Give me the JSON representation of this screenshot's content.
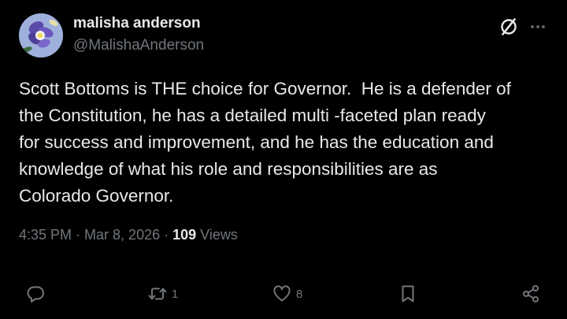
{
  "tweet": {
    "author": {
      "display_name": "malisha anderson",
      "handle": "@MalishaAnderson"
    },
    "text_lines": [
      "Scott Bottoms is THE choice for Governor.  He is a defender of",
      "the Constitution, he has a detailed multi -faceted plan ready",
      "for success and improvement, and he has the education and",
      "knowledge of what his role and responsibilities are as",
      "Colorado Governor."
    ],
    "meta": {
      "time": "4:35 PM",
      "separator1": " · ",
      "date": "Mar 8, 2026",
      "separator2": " · ",
      "views_count": "109",
      "views_label": " Views"
    },
    "actions": {
      "reply": {
        "icon": "reply-icon",
        "count": ""
      },
      "repost": {
        "icon": "repost-icon",
        "count": "1"
      },
      "like": {
        "icon": "heart-icon",
        "count": "8"
      },
      "bookmark": {
        "icon": "bookmark-icon",
        "count": ""
      },
      "share": {
        "icon": "share-icon",
        "count": ""
      }
    }
  },
  "colors": {
    "background": "#000000",
    "text_primary": "#e7e9ea",
    "text_secondary": "#71767b"
  }
}
